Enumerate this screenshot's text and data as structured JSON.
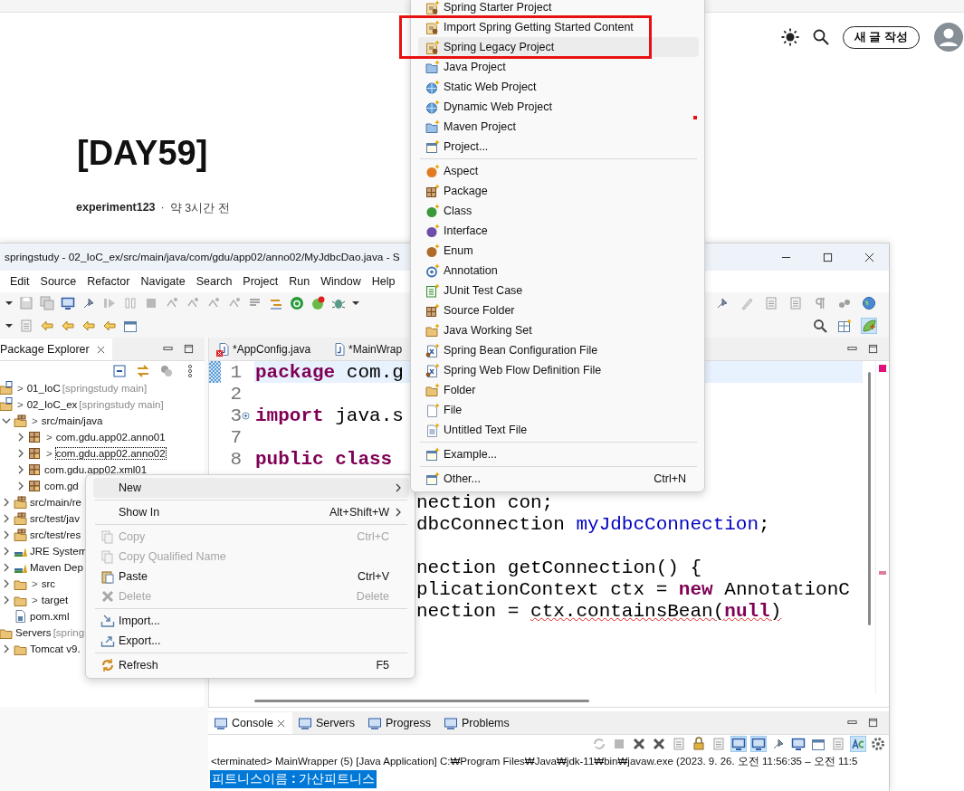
{
  "blog": {
    "write_button": "새 글 작성",
    "title": "[DAY59]",
    "author": "experiment123",
    "separator": "·",
    "time": "약 3시간 전"
  },
  "ide": {
    "title": "springstudy - 02_IoC_ex/src/main/java/com/gdu/app02/anno02/MyJdbcDao.java - S",
    "menu": [
      "Edit",
      "Source",
      "Refactor",
      "Navigate",
      "Search",
      "Project",
      "Run",
      "Window",
      "Help"
    ],
    "package_explorer": {
      "tab": "Package Explorer",
      "tree": [
        {
          "label": "01_IoC",
          "marker": ">",
          "decoration": "[springstudy main]",
          "kind": "project",
          "selected": false
        },
        {
          "label": "02_IoC_ex",
          "marker": ">",
          "decoration": "[springstudy main]",
          "kind": "project",
          "selected": false,
          "children": [
            {
              "label": "src/main/java",
              "marker": ">",
              "kind": "source",
              "expanded": true,
              "selected": false,
              "children": [
                {
                  "label": "com.gdu.app02.anno01",
                  "marker": ">",
                  "kind": "package",
                  "expanded": false,
                  "selected": false
                },
                {
                  "label": "com.gdu.app02.anno02",
                  "marker": ">",
                  "kind": "package",
                  "expanded": false,
                  "selected": true
                },
                {
                  "label": "com.gdu.app02.xml01",
                  "kind": "package",
                  "expanded": false,
                  "selected": false
                },
                {
                  "label": "com.gd",
                  "kind": "package",
                  "expanded": false,
                  "selected": false
                }
              ]
            },
            {
              "label": "src/main/re",
              "kind": "source",
              "expanded": false,
              "selected": false
            },
            {
              "label": "src/test/jav",
              "kind": "source",
              "expanded": false,
              "selected": false
            },
            {
              "label": "src/test/res",
              "kind": "source",
              "expanded": false,
              "selected": false
            },
            {
              "label": "JRE System",
              "kind": "library",
              "expanded": false,
              "selected": false
            },
            {
              "label": "Maven Dep",
              "kind": "library",
              "expanded": false,
              "selected": false
            },
            {
              "label": "src",
              "marker": ">",
              "kind": "folder",
              "expanded": false,
              "selected": false
            },
            {
              "label": "target",
              "marker": ">",
              "kind": "folder",
              "expanded": false,
              "selected": false
            },
            {
              "label": "pom.xml",
              "kind": "file",
              "selected": false
            }
          ]
        },
        {
          "label": "Servers",
          "decoration": "[spring",
          "kind": "folder",
          "selected": false,
          "children": [
            {
              "label": "Tomcat v9.",
              "kind": "folder",
              "expanded": false,
              "selected": false
            }
          ]
        }
      ]
    },
    "editor": {
      "tabs": [
        {
          "label": "*AppConfig.java",
          "error": true
        },
        {
          "label": "*MainWrap",
          "error": false
        }
      ],
      "lines": [
        {
          "number": "1",
          "current": true,
          "folded": false,
          "tokens": [
            {
              "text": "package",
              "kind": "keyword"
            },
            {
              "text": " com.g",
              "kind": "plain"
            }
          ]
        },
        {
          "number": "2",
          "current": false,
          "folded": false
        },
        {
          "number": "3",
          "current": false,
          "folded": true,
          "tokens": [
            {
              "text": "import",
              "kind": "keyword"
            },
            {
              "text": " java.s",
              "kind": "plain"
            }
          ]
        },
        {
          "number": "7",
          "current": false,
          "folded": false
        },
        {
          "number": "8",
          "current": false,
          "folded": false,
          "tokens": [
            {
              "text": "public class",
              "kind": "keyword"
            }
          ]
        },
        {
          "current": false
        },
        {
          "current": false,
          "tokens": [
            {
              "text": "nection con;",
              "kind": "plain"
            }
          ]
        },
        {
          "current": false,
          "tokens": [
            {
              "text": "dbcConnection ",
              "kind": "plain"
            },
            {
              "text": "myJdbcConnection",
              "kind": "field"
            },
            {
              "text": ";",
              "kind": "plain"
            }
          ]
        },
        {
          "current": false
        },
        {
          "current": false,
          "tokens": [
            {
              "text": "nection getConnection() {",
              "kind": "plain"
            }
          ]
        },
        {
          "current": false,
          "tokens": [
            {
              "text": "plicationContext ctx = ",
              "kind": "plain"
            },
            {
              "text": "new",
              "kind": "keyword"
            },
            {
              "text": " AnnotationC",
              "kind": "plain"
            }
          ]
        },
        {
          "current": false,
          "tokens": [
            {
              "text": "nection = ",
              "kind": "plain"
            },
            {
              "text": "ctx.containsBean(",
              "kind": "error"
            },
            {
              "text": "null",
              "kind": "error_keyword"
            },
            {
              "text": ")",
              "kind": "error"
            }
          ]
        }
      ]
    },
    "console": {
      "tabs": [
        {
          "label": "Console",
          "selected": true
        },
        {
          "label": "Servers",
          "selected": false
        },
        {
          "label": "Progress",
          "selected": false
        },
        {
          "label": "Problems",
          "selected": false
        }
      ],
      "status": "<terminated> MainWrapper (5) [Java Application] C:₩Program Files₩Java₩jdk-11₩bin₩javaw.exe  (2023. 9. 26. 오전 11:56:35 – 오전 11:5",
      "output": "피트니스이름 **:** 가산피트니스"
    }
  },
  "context_menu": {
    "items": [
      {
        "kind": "item",
        "label": "New",
        "submenu": true,
        "selected": true,
        "disabled": false
      },
      {
        "kind": "separator"
      },
      {
        "kind": "item",
        "label": "Show In",
        "shortcut": "Alt+Shift+W",
        "submenu": true,
        "selected": false,
        "disabled": false
      },
      {
        "kind": "separator"
      },
      {
        "kind": "item",
        "label": "Copy",
        "shortcut": "Ctrl+C",
        "submenu": false,
        "selected": false,
        "disabled": true
      },
      {
        "kind": "item",
        "label": "Copy Qualified Name",
        "submenu": false,
        "selected": false,
        "disabled": true
      },
      {
        "kind": "item",
        "label": "Paste",
        "shortcut": "Ctrl+V",
        "submenu": false,
        "selected": false,
        "disabled": false
      },
      {
        "kind": "item",
        "label": "Delete",
        "shortcut": "Delete",
        "submenu": false,
        "selected": false,
        "disabled": true
      },
      {
        "kind": "separator"
      },
      {
        "kind": "item",
        "label": "Import...",
        "submenu": false,
        "selected": false,
        "disabled": false
      },
      {
        "kind": "item",
        "label": "Export...",
        "submenu": false,
        "selected": false,
        "disabled": false
      },
      {
        "kind": "separator"
      },
      {
        "kind": "item",
        "label": "Refresh",
        "shortcut": "F5",
        "submenu": false,
        "selected": false,
        "disabled": false
      }
    ]
  },
  "new_submenu": {
    "items": [
      {
        "kind": "item",
        "label": "Spring Starter Project",
        "selected": false
      },
      {
        "kind": "item",
        "label": "Import Spring Getting Started Content",
        "selected": false
      },
      {
        "kind": "item",
        "label": "Spring Legacy Project",
        "selected": true
      },
      {
        "kind": "item",
        "label": "Java Project",
        "selected": false
      },
      {
        "kind": "item",
        "label": "Static Web Project",
        "selected": false
      },
      {
        "kind": "item",
        "label": "Dynamic Web Project",
        "selected": false
      },
      {
        "kind": "item",
        "label": "Maven Project",
        "selected": false
      },
      {
        "kind": "item",
        "label": "Project...",
        "selected": false
      },
      {
        "kind": "separator"
      },
      {
        "kind": "item",
        "label": "Aspect",
        "selected": false
      },
      {
        "kind": "item",
        "label": "Package",
        "selected": false
      },
      {
        "kind": "item",
        "label": "Class",
        "selected": false
      },
      {
        "kind": "item",
        "label": "Interface",
        "selected": false
      },
      {
        "kind": "item",
        "label": "Enum",
        "selected": false
      },
      {
        "kind": "item",
        "label": "Annotation",
        "selected": false
      },
      {
        "kind": "item",
        "label": "JUnit Test Case",
        "selected": false
      },
      {
        "kind": "item",
        "label": "Source Folder",
        "selected": false
      },
      {
        "kind": "item",
        "label": "Java Working Set",
        "selected": false
      },
      {
        "kind": "item",
        "label": "Spring Bean Configuration File",
        "selected": false
      },
      {
        "kind": "item",
        "label": "Spring Web Flow Definition File",
        "selected": false
      },
      {
        "kind": "item",
        "label": "Folder",
        "selected": false
      },
      {
        "kind": "item",
        "label": "File",
        "selected": false
      },
      {
        "kind": "item",
        "label": "Untitled Text File",
        "selected": false
      },
      {
        "kind": "separator"
      },
      {
        "kind": "item",
        "label": "Example...",
        "selected": false
      },
      {
        "kind": "separator"
      },
      {
        "kind": "item",
        "label": "Other...",
        "shortcut": "Ctrl+N",
        "selected": false
      }
    ]
  }
}
